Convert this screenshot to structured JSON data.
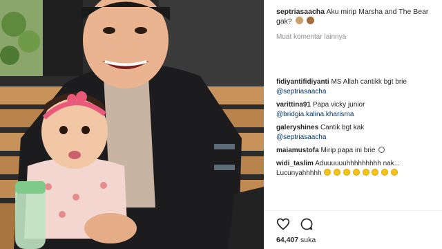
{
  "post": {
    "username": "septriasaacha",
    "caption": "Aku mirip Marsha and The Bear gak?",
    "caption_emojis": [
      "monkey-face-emoji",
      "bear-face-emoji"
    ],
    "load_more": "Muat komentar lainnya"
  },
  "comments": [
    {
      "username": "fidiyantifidiyanti",
      "text": "MS Allah cantikk bgt brie",
      "mention": "@septriasaacha"
    },
    {
      "username": "varittina91",
      "text": "Papa vicky junior",
      "mention": "@bridgia.kalina.kharisma"
    },
    {
      "username": "galeryshines",
      "text": "Cantik bgt kak",
      "mention": "@septriasaacha"
    },
    {
      "username": "maiamustofa",
      "text": "Mirip papa ini brie",
      "mention": ""
    },
    {
      "username": "widi_taslim",
      "text": "Aduuuuuuhhhhhhhhh nak...",
      "text2": "Lucunyahhhhh",
      "mention": ""
    }
  ],
  "actions": {
    "like_icon": "heart-icon",
    "comment_icon": "comment-bubble-icon"
  },
  "likes": {
    "count": "64,407",
    "label": "suka"
  },
  "colors": {
    "text": "#262626",
    "muted": "#8e8e8e",
    "mention": "#003569"
  }
}
